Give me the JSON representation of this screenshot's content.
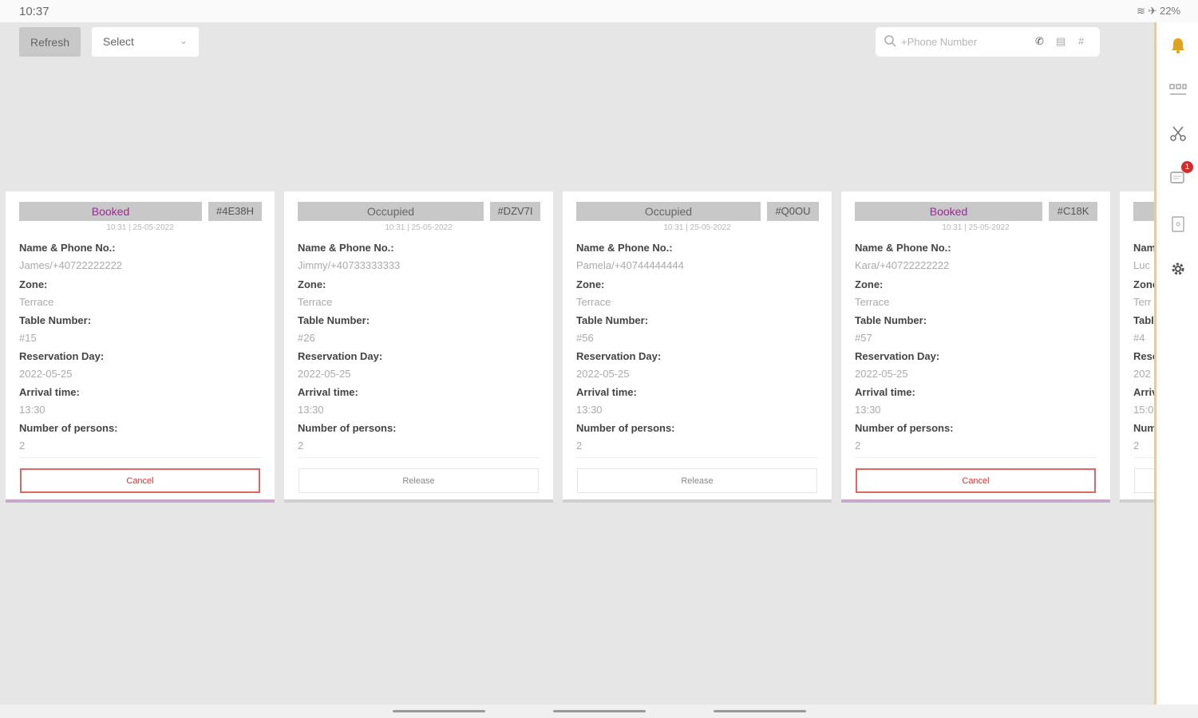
{
  "status_bar": {
    "time": "10:37",
    "system": "22%"
  },
  "toolbar": {
    "refresh_label": "Refresh",
    "select_value": "Select",
    "search_placeholder": "+Phone Number"
  },
  "sidebar": {
    "items": [
      "bell-icon",
      "grid-icon",
      "scissors-icon",
      "messages-icon",
      "document-icon",
      "gear-icon"
    ],
    "notification_count": "1"
  },
  "labels": {
    "name_phone": "Name & Phone No.:",
    "zone": "Zone:",
    "table_number": "Table Number:",
    "reservation_day": "Reservation Day:",
    "arrival_time": "Arrival time:",
    "persons": "Number of persons:"
  },
  "cards": [
    {
      "status": "Booked",
      "code": "#4E38H",
      "timestamp": "10:31 | 25-05-2022",
      "name_phone": "James/+40722222222",
      "zone": "Terrace",
      "table": "#15",
      "day": "2022-05-25",
      "arrival": "13:30",
      "persons": "2",
      "action": "Cancel"
    },
    {
      "status": "Occupied",
      "code": "#DZV7I",
      "timestamp": "10:31 | 25-05-2022",
      "name_phone": "Jimmy/+40733333333",
      "zone": "Terrace",
      "table": "#26",
      "day": "2022-05-25",
      "arrival": "13:30",
      "persons": "2",
      "action": "Release"
    },
    {
      "status": "Occupied",
      "code": "#Q0OU",
      "timestamp": "10:31 | 25-05-2022",
      "name_phone": "Pamela/+40744444444",
      "zone": "Terrace",
      "table": "#56",
      "day": "2022-05-25",
      "arrival": "13:30",
      "persons": "2",
      "action": "Release"
    },
    {
      "status": "Booked",
      "code": "#C18K",
      "timestamp": "10:31 | 25-05-2022",
      "name_phone": "Kara/+40722222222",
      "zone": "Terrace",
      "table": "#57",
      "day": "2022-05-25",
      "arrival": "13:30",
      "persons": "2",
      "action": "Cancel"
    },
    {
      "status": "",
      "code": "",
      "timestamp": "",
      "name_phone": "Luc",
      "zone": "Terr",
      "table": "#4",
      "day": "202",
      "arrival": "15:0",
      "persons": "2",
      "action": ""
    }
  ]
}
